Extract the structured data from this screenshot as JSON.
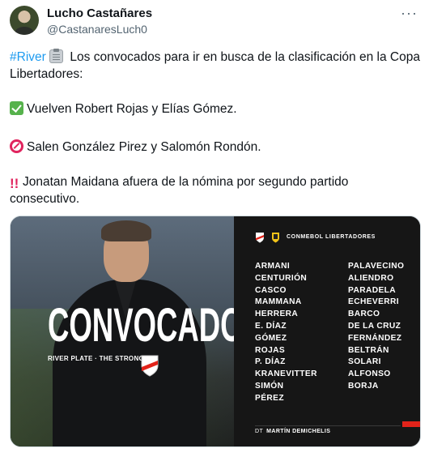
{
  "author": {
    "name": "Lucho Castañares",
    "handle": "@CastanaresLuch0"
  },
  "tweet": {
    "hashtag": "#River",
    "line1_rest": " Los convocados para ir en busca de la clasificación en la Copa",
    "line2": "Libertadores:",
    "line3": "Vuelven Robert Rojas y Elías Gómez.",
    "line4": "Salen González Pirez y Salomón Rondón.",
    "line5": "Jonatan Maidana afuera de la nómina por segundo partido",
    "line6": "consecutivo.",
    "emojis": [
      "clipboard-icon",
      "check-mark-icon",
      "no-entry-icon",
      "double-exclamation-icon"
    ]
  },
  "more_label": "···",
  "card": {
    "title": "CONVOCADOS",
    "subtitle": "RIVER PLATE · THE STRONGEST",
    "league": "CONMEBOL LIBERTADORES",
    "left_column": [
      "ARMANI",
      "CENTURIÓN",
      "CASCO",
      "MAMMANA",
      "HERRERA",
      "E. DÍAZ",
      "GÓMEZ",
      "ROJAS",
      "P. DÍAZ",
      "KRANEVITTER",
      "SIMÓN",
      "PÉREZ"
    ],
    "right_column": [
      "PALAVECINO",
      "ALIENDRO",
      "PARADELA",
      "ECHEVERRI",
      "BARCO",
      "DE LA CRUZ",
      "FERNÁNDEZ",
      "BELTRÁN",
      "SOLARI",
      "ALFONSO",
      "BORJA"
    ],
    "dt_label": "DT",
    "dt_name": "MARTÍN DEMICHELIS",
    "accent_color": "#e2231a"
  }
}
